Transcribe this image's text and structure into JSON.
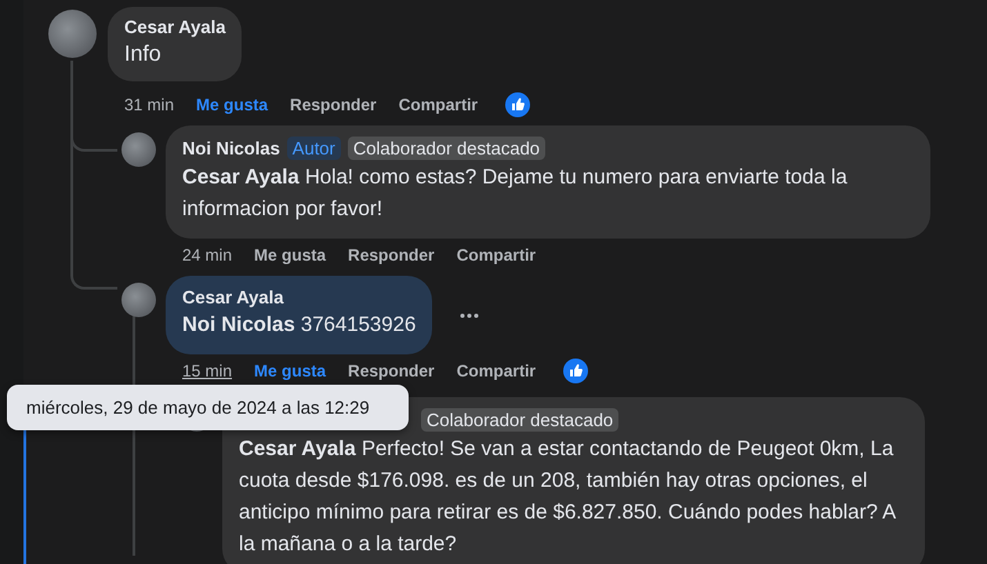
{
  "comments": [
    {
      "author": "Cesar Ayala",
      "text": "Info",
      "highlighted": false,
      "menu_visible": false,
      "actions": {
        "time": "31 min",
        "time_hovered": false,
        "like": "Me gusta",
        "reply": "Responder",
        "share": "Compartir",
        "liked": true
      },
      "children": [
        {
          "author": "Noi Nicolas",
          "badges": [
            {
              "label": "Autor",
              "kind": "author"
            },
            {
              "label": "Colaborador destacado",
              "kind": "contributor"
            }
          ],
          "mention": "Cesar Ayala",
          "text": "Hola! como estas? Dejame tu numero para enviarte toda la informacion por favor!",
          "highlighted": false,
          "menu_visible": false,
          "actions": {
            "time": "24 min",
            "time_hovered": false,
            "like": "Me gusta",
            "reply": "Responder",
            "share": "Compartir",
            "liked": false
          }
        },
        {
          "author": "Cesar Ayala",
          "mention": "Noi Nicolas",
          "text": "3764153926",
          "highlighted": true,
          "menu_visible": true,
          "actions": {
            "time": "15 min",
            "time_hovered": true,
            "like": "Me gusta",
            "reply": "Responder",
            "share": "Compartir",
            "liked": true
          },
          "children": [
            {
              "badges": [
                {
                  "label": "Colaborador destacado",
                  "kind": "contributor"
                }
              ],
              "mention": "Cesar Ayala",
              "text": "Perfecto! Se van a estar contactando de Peugeot 0km, La cuota desde $176.098. es de un 208, también hay otras opciones, el anticipo mínimo para retirar es de $6.827.850. Cuándo podes hablar? A la mañana o a la tarde?",
              "highlighted": false,
              "menu_visible": false
            }
          ]
        }
      ]
    }
  ],
  "tooltip": {
    "text": "miércoles, 29 de mayo de 2024 a las 12:29"
  }
}
